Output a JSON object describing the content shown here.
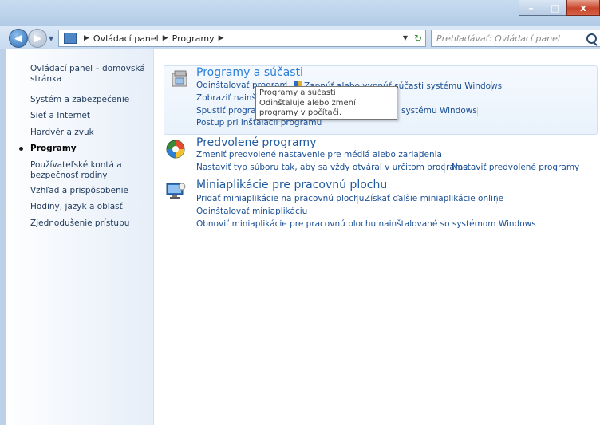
{
  "window": {
    "minimize": "–",
    "maximize": "□",
    "close": "x"
  },
  "navbar": {
    "breadcrumbs": [
      "Ovládací panel",
      "Programy"
    ],
    "search_placeholder": "Prehľadávať: Ovládací panel"
  },
  "sidebar": {
    "items": [
      {
        "label": "Ovládací panel – domovská stránka",
        "active": false
      },
      {
        "label": "Systém a zabezpečenie",
        "active": false
      },
      {
        "label": "Sieť a Internet",
        "active": false
      },
      {
        "label": "Hardvér a zvuk",
        "active": false
      },
      {
        "label": "Programy",
        "active": true
      },
      {
        "label": "Používateľské kontá a bezpečnosť rodiny",
        "active": false
      },
      {
        "label": "Vzhľad a prispôsobenie",
        "active": false
      },
      {
        "label": "Hodiny, jazyk a oblasť",
        "active": false
      },
      {
        "label": "Zjednodušenie prístupu",
        "active": false
      }
    ]
  },
  "categories": [
    {
      "title": "Programy a súčasti",
      "tasks": [
        "Odinštalovať program",
        "Zapnúť alebo vypnúť súčasti systému Windows",
        "Zobraziť nainšta",
        "Spustiť program",
        "systému Windows",
        "Postup pri inštalácii programu"
      ]
    },
    {
      "title": "Predvolené programy",
      "tasks": [
        "Zmeniť predvolené nastavenie pre médiá alebo zariadenia",
        "Nastaviť typ súboru tak, aby sa vždy otváral v určitom programe",
        "Nastaviť predvolené programy"
      ]
    },
    {
      "title": "Miniaplikácie pre pracovnú plochu",
      "tasks": [
        "Pridať miniaplikácie na pracovnú plochu",
        "Získať ďalšie miniaplikácie online",
        "Odinštalovať miniaplikáciu",
        "Obnoviť miniaplikácie pre pracovnú plochu nainštalované so systémom Windows"
      ]
    }
  ],
  "tooltip": {
    "title": "Programy a súčasti",
    "text": "Odinštaluje alebo zmení programy v počítači."
  },
  "colors": {
    "link": "#1a4f94",
    "title": "#1e5a9e",
    "accent": "#2b7fd8"
  }
}
